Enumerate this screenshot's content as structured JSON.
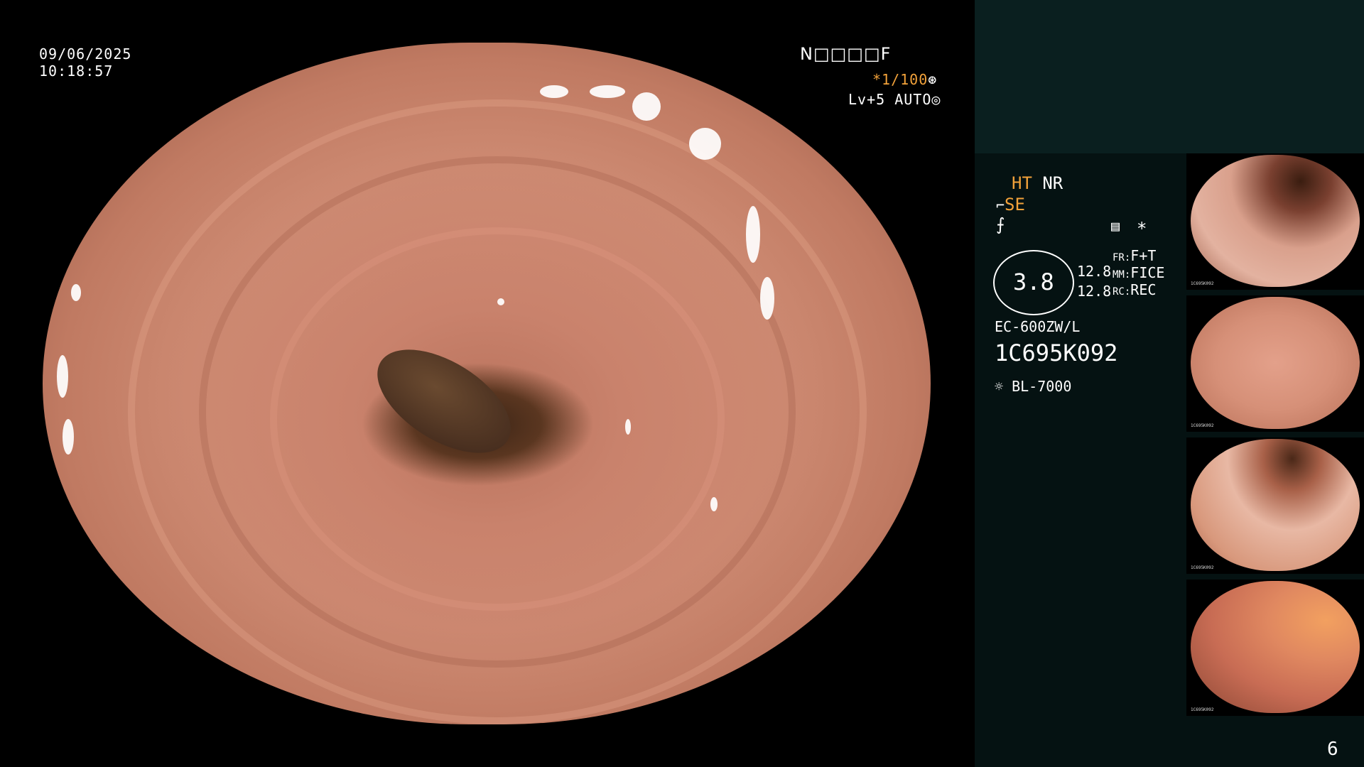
{
  "osd": {
    "date": "09/06/2025",
    "time": "10:18:57",
    "mode_code": "N□□□□F",
    "shutter": "*1/100",
    "level": "Lv+5",
    "exposure": "AUTO"
  },
  "panel": {
    "ht": "HT",
    "nr": "NR",
    "se": "SE",
    "magnification": "3.8",
    "value_1": "12.8",
    "value_2": "12.8",
    "fr_label": "FR:",
    "fr_value": "F+T",
    "mm_label": "MM:",
    "mm_value": "FICE",
    "rc_label": "RC:",
    "rc_value": "REC",
    "scope_model": "EC-600ZW/L",
    "scope_serial": "1C695K092",
    "light_source": "BL-7000",
    "page_number": "6",
    "star": "*"
  },
  "thumbnails": [
    {
      "serial": "1C695K092"
    },
    {
      "serial": "1C695K092"
    },
    {
      "serial": "1C695K092"
    },
    {
      "serial": "1C695K092"
    }
  ],
  "icons": {
    "shutter": "gear-icon",
    "exposure": "aperture-icon",
    "light": "sun-icon",
    "settings": "menu-icon"
  },
  "colors": {
    "orange_accent": "#f2a23a",
    "panel_bg": "#051212",
    "panel_top_bg": "#0a1f1f"
  }
}
